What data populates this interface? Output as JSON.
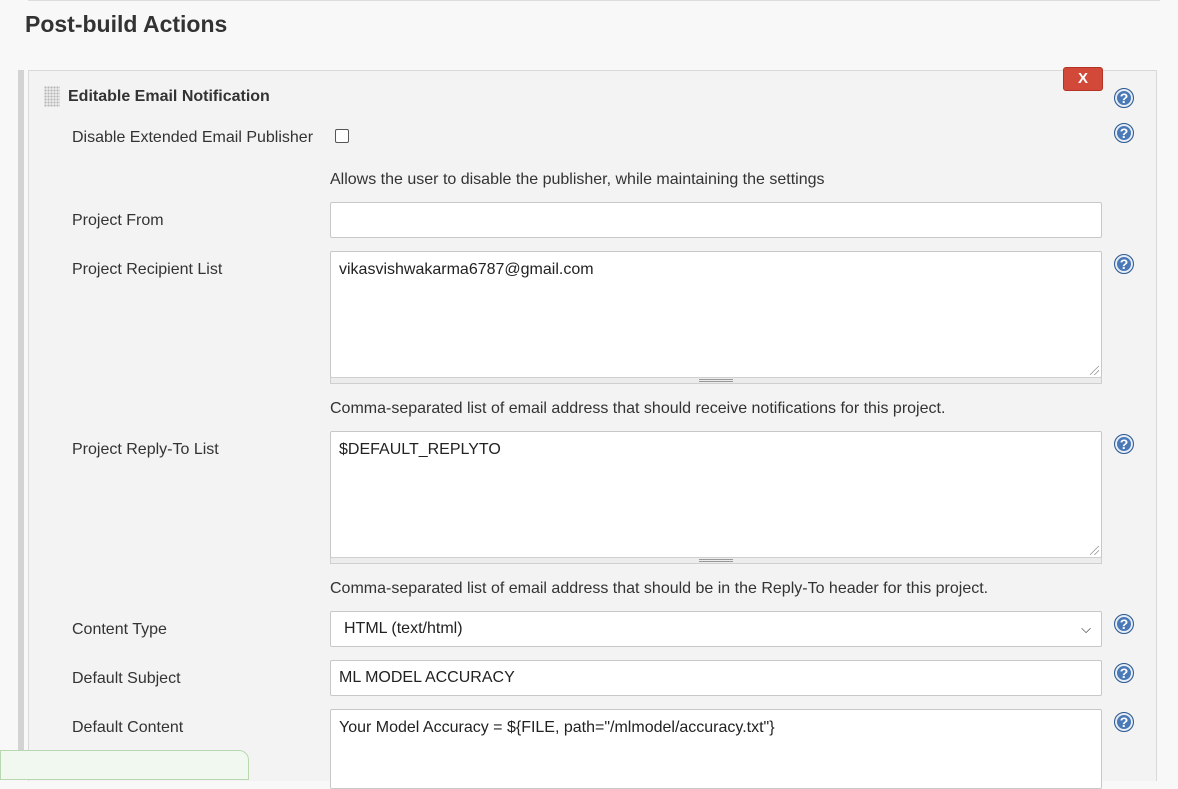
{
  "section": {
    "title": "Post-build Actions"
  },
  "panel": {
    "title": "Editable Email Notification",
    "close_label": "X"
  },
  "help": {
    "glyph": "?"
  },
  "fields": {
    "disable_publisher": {
      "label": "Disable Extended Email Publisher",
      "checked": false,
      "description": "Allows the user to disable the publisher, while maintaining the settings"
    },
    "project_from": {
      "label": "Project From",
      "value": ""
    },
    "recipient_list": {
      "label": "Project Recipient List",
      "value": "vikasvishwakarma6787@gmail.com",
      "description": "Comma-separated list of email address that should receive notifications for this project."
    },
    "reply_to_list": {
      "label": "Project Reply-To List",
      "value": "$DEFAULT_REPLYTO",
      "description": "Comma-separated list of email address that should be in the Reply-To header for this project."
    },
    "content_type": {
      "label": "Content Type",
      "selected": "HTML (text/html)"
    },
    "default_subject": {
      "label": "Default Subject",
      "value": "ML MODEL ACCURACY"
    },
    "default_content": {
      "label": "Default Content",
      "value": "Your Model Accuracy = ${FILE, path=\"/mlmodel/accuracy.txt\"}"
    }
  },
  "icons": {
    "help": "help-icon",
    "drag": "drag-handle-icon",
    "dropdown": "chevron-down-icon"
  },
  "colors": {
    "close_button": "#d24939",
    "help_icon": "#4a79b7"
  }
}
